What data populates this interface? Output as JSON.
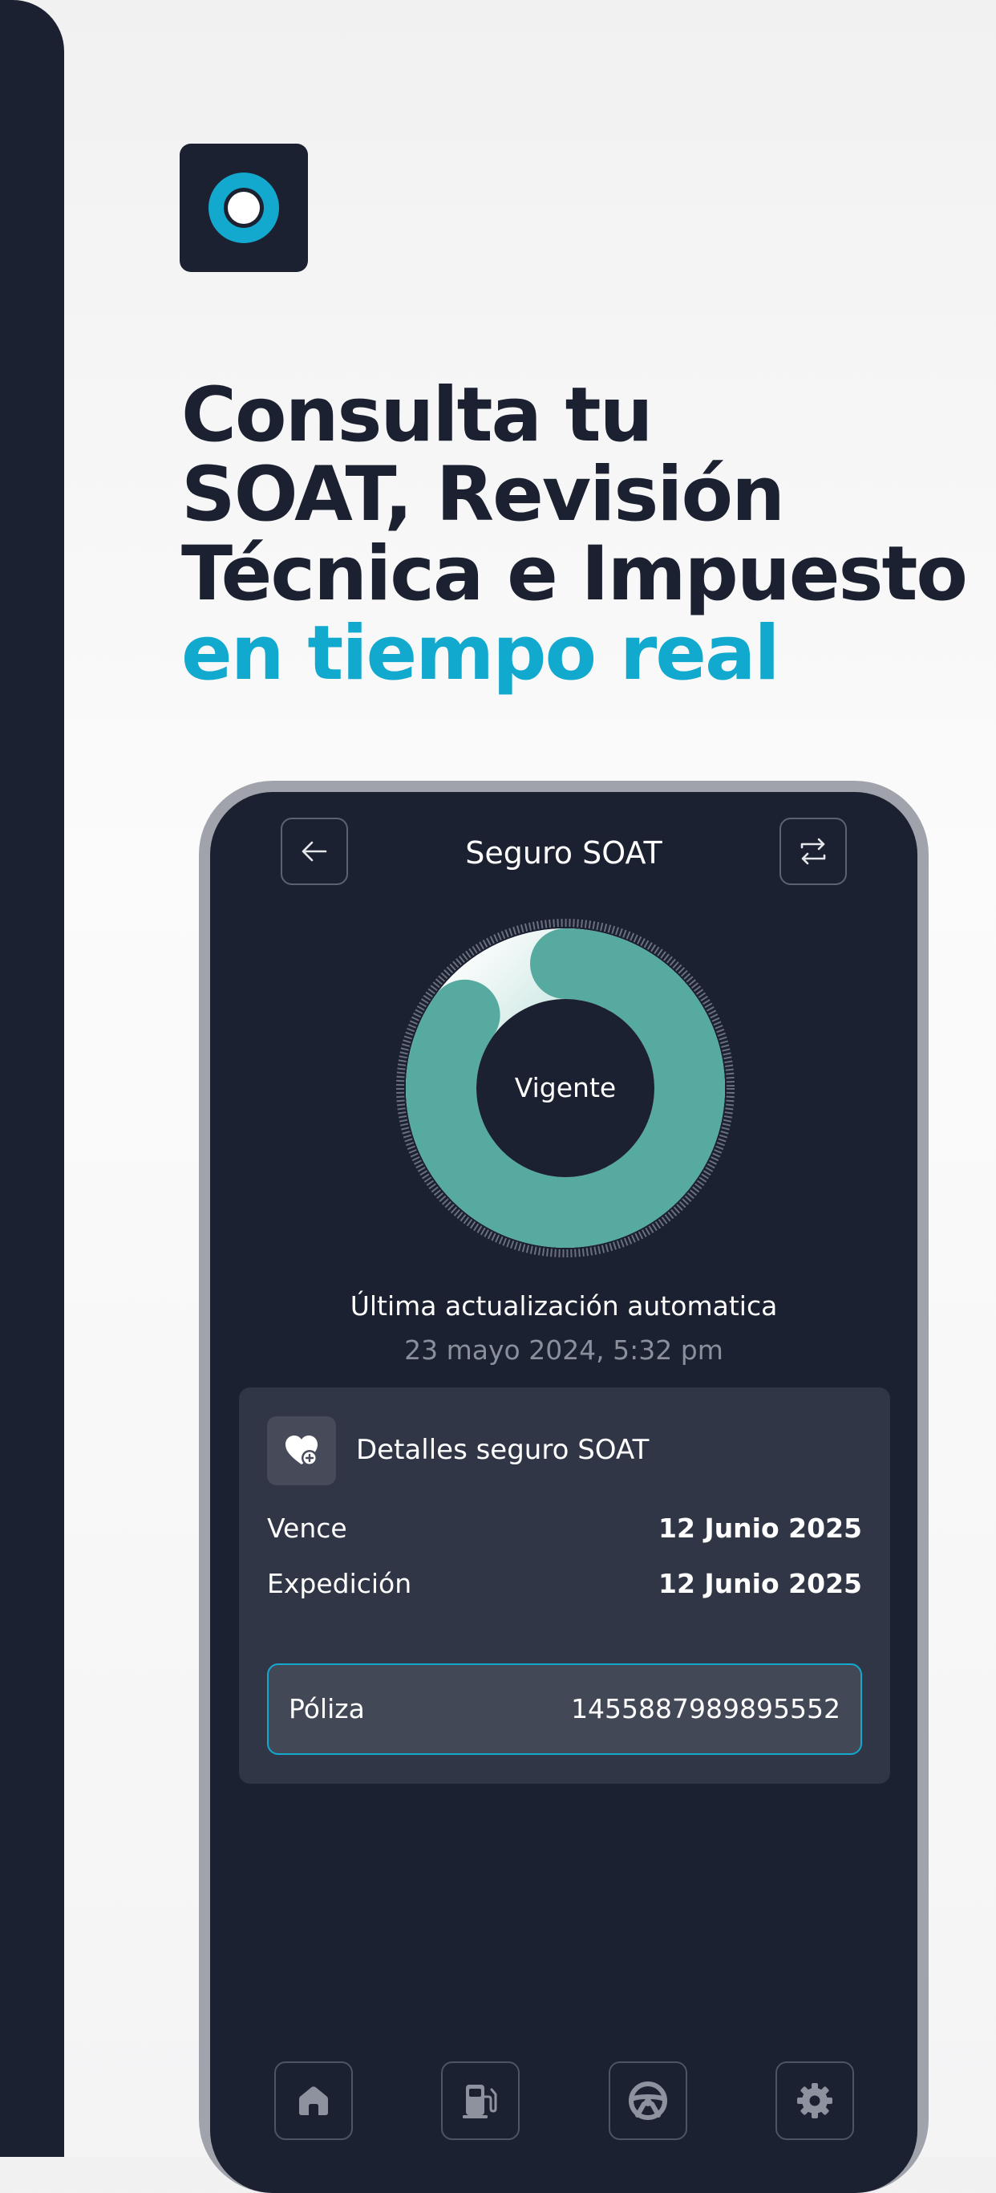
{
  "hero": {
    "title_lines": [
      "Consulta tu",
      "SOAT, Revisión",
      "Técnica e Impuesto"
    ],
    "title_accent": "en tiempo real"
  },
  "screen": {
    "title": "Seguro SOAT",
    "status": "Vigente",
    "status_fraction": 0.85,
    "update_label": "Última actualización automatica",
    "update_date": "23 mayo 2024, 5:32 pm",
    "card": {
      "title": "Detalles seguro SOAT",
      "rows": [
        {
          "label": "Vence",
          "value": "12 Junio 2025"
        },
        {
          "label": "Expedición",
          "value": "12 Junio 2025"
        }
      ],
      "policy_label": "Póliza",
      "policy_number": "1455887989895552"
    },
    "nav": [
      "home-icon",
      "fuel-pump-icon",
      "steering-wheel-icon",
      "gear-icon"
    ]
  },
  "colors": {
    "navy": "#1c2131",
    "accent": "#12a9cf",
    "teal": "#56aaa0",
    "card": "#313646"
  }
}
